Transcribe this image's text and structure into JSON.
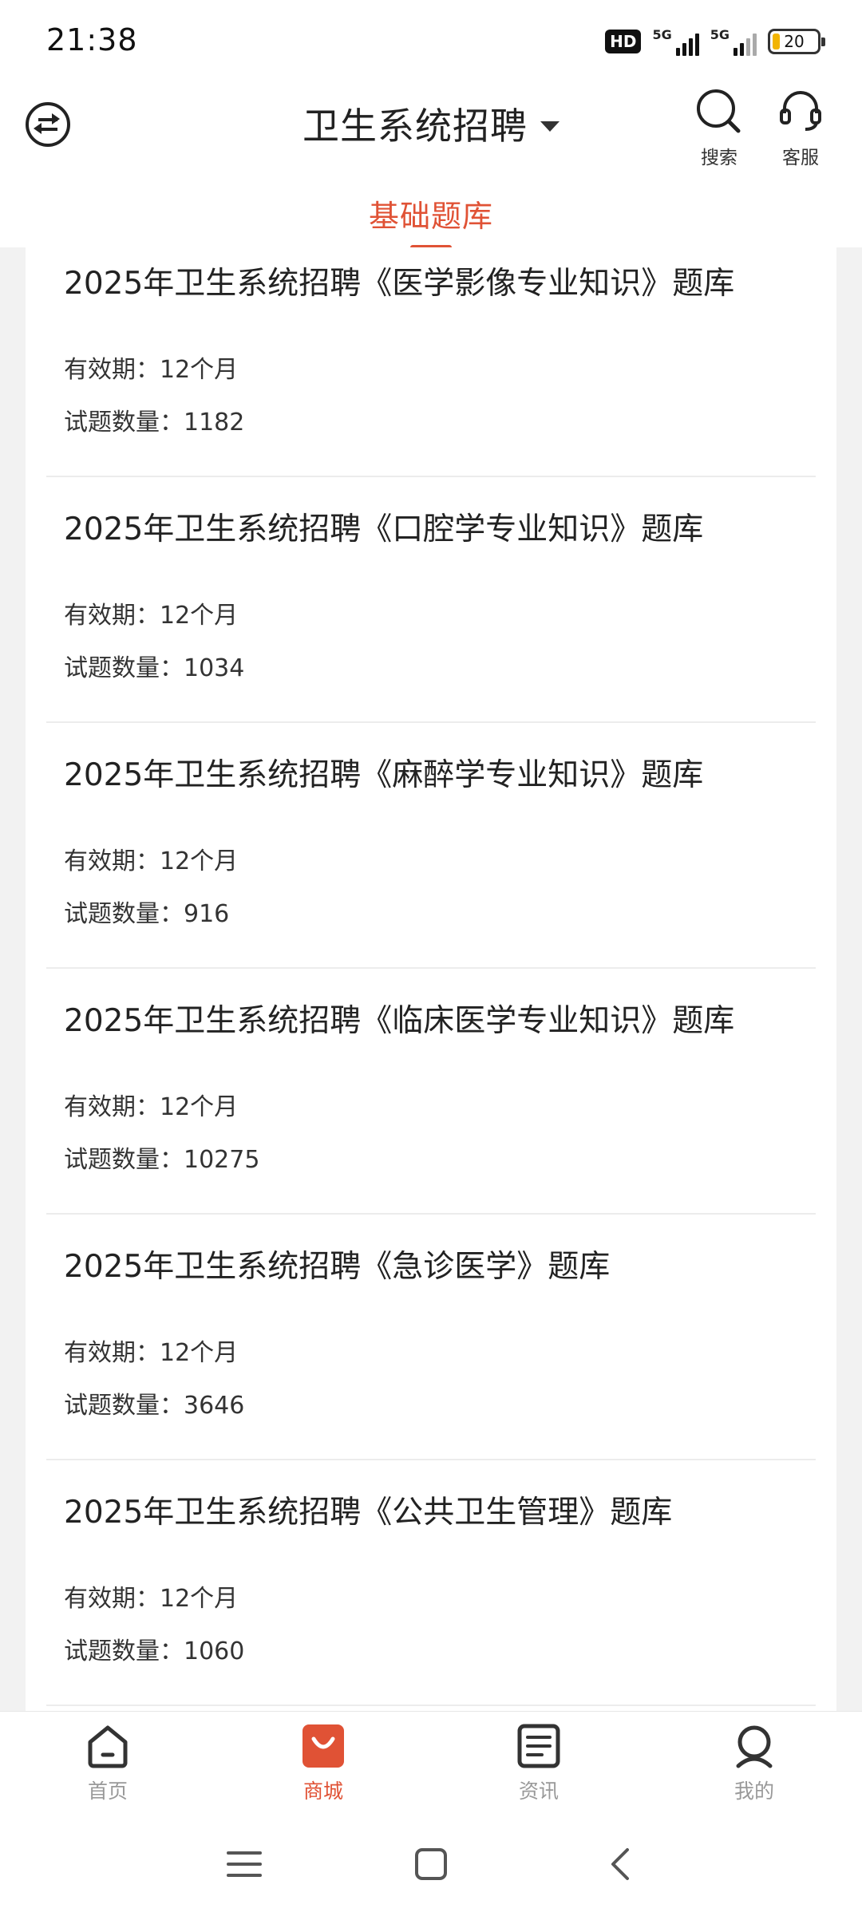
{
  "status_bar": {
    "time": "21:38",
    "hd_label": "HD",
    "network_1": "5G",
    "network_2": "5G",
    "battery": "20"
  },
  "header": {
    "title": "卫生系统招聘",
    "search_label": "搜索",
    "service_label": "客服",
    "active_tab": "基础题库"
  },
  "items": [
    {
      "name": "2025年卫生系统招聘《医学影像专业知识》题库",
      "validity_label": "有效期：",
      "validity": "12个月",
      "count_label": "试题数量：",
      "count": "1182"
    },
    {
      "name": "2025年卫生系统招聘《口腔学专业知识》题库",
      "validity_label": "有效期：",
      "validity": "12个月",
      "count_label": "试题数量：",
      "count": "1034"
    },
    {
      "name": "2025年卫生系统招聘《麻醉学专业知识》题库",
      "validity_label": "有效期：",
      "validity": "12个月",
      "count_label": "试题数量：",
      "count": "916"
    },
    {
      "name": "2025年卫生系统招聘《临床医学专业知识》题库",
      "validity_label": "有效期：",
      "validity": "12个月",
      "count_label": "试题数量：",
      "count": "10275"
    },
    {
      "name": "2025年卫生系统招聘《急诊医学》题库",
      "validity_label": "有效期：",
      "validity": "12个月",
      "count_label": "试题数量：",
      "count": "3646"
    },
    {
      "name": "2025年卫生系统招聘《公共卫生管理》题库",
      "validity_label": "有效期：",
      "validity": "12个月",
      "count_label": "试题数量：",
      "count": "1060"
    }
  ],
  "bottom_nav": {
    "home": "首页",
    "mall": "商城",
    "news": "资讯",
    "mine": "我的",
    "active": "mall"
  },
  "colors": {
    "accent": "#e05235",
    "text": "#222222",
    "inactive": "#999999"
  }
}
